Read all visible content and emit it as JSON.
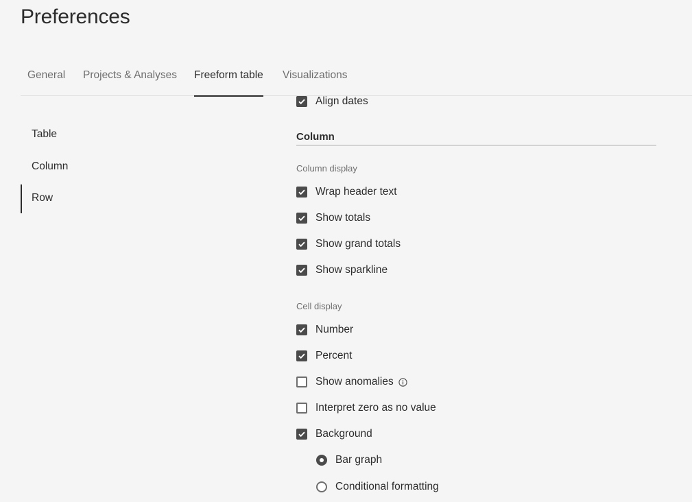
{
  "page": {
    "title": "Preferences"
  },
  "tabs": [
    {
      "label": "General",
      "selected": false
    },
    {
      "label": "Projects & Analyses",
      "selected": false
    },
    {
      "label": "Freeform table",
      "selected": true
    },
    {
      "label": "Visualizations",
      "selected": false
    }
  ],
  "sidebar": {
    "items": [
      {
        "label": "Table",
        "selected": false
      },
      {
        "label": "Column",
        "selected": false
      },
      {
        "label": "Row",
        "selected": true
      }
    ]
  },
  "content": {
    "align_dates": {
      "label": "Align dates",
      "checked": true
    },
    "column_section": {
      "heading": "Column",
      "column_display": {
        "label": "Column display",
        "options": [
          {
            "label": "Wrap header text",
            "checked": true
          },
          {
            "label": "Show totals",
            "checked": true
          },
          {
            "label": "Show grand totals",
            "checked": true
          },
          {
            "label": "Show sparkline",
            "checked": true
          }
        ]
      },
      "cell_display": {
        "label": "Cell display",
        "options": [
          {
            "label": "Number",
            "checked": true
          },
          {
            "label": "Percent",
            "checked": true
          },
          {
            "label": "Show anomalies",
            "checked": false,
            "icon": "info-icon"
          },
          {
            "label": "Interpret zero as no value",
            "checked": false
          },
          {
            "label": "Background",
            "checked": true
          }
        ],
        "background_options": [
          {
            "label": "Bar graph",
            "selected": true
          },
          {
            "label": "Conditional formatting",
            "selected": false
          }
        ]
      }
    }
  },
  "colors": {
    "background": "#f5f5f5",
    "text": "#2c2c2c",
    "muted_text": "#6e6e6e",
    "control": "#4b4b4b"
  }
}
